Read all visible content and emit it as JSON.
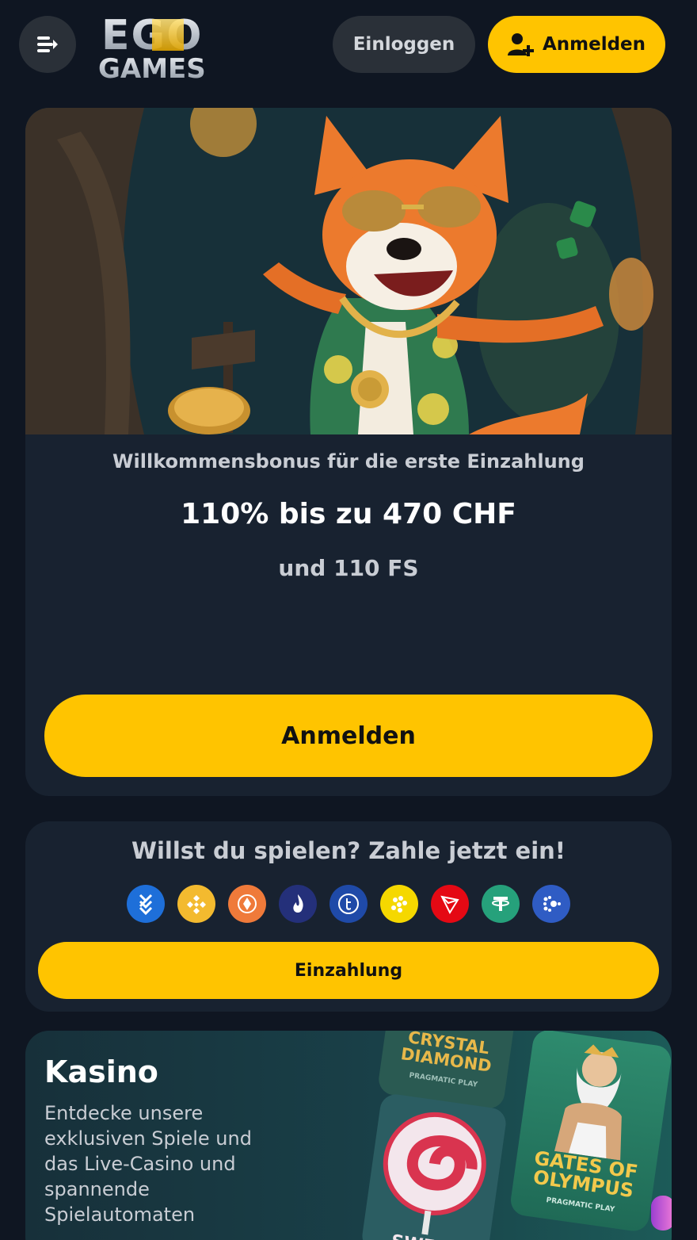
{
  "header": {
    "logo": {
      "top": "EGO",
      "bottom": "GAMES"
    },
    "login_label": "Einloggen",
    "signup_label": "Anmelden"
  },
  "promo": {
    "subtitle": "Willkommensbonus für die erste Einzahlung",
    "headline": "110% bis zu 470 CHF",
    "extra": "und 110 FS",
    "cta_label": "Anmelden"
  },
  "deposit": {
    "title": "Willst du spielen? Zahle jetzt ein!",
    "coins": [
      {
        "name": "bitcoin-blue-icon",
        "color": "#1e6fd9"
      },
      {
        "name": "binance-icon",
        "color": "#f3ba2f"
      },
      {
        "name": "diamond-coin-icon",
        "color": "#ef7a3a"
      },
      {
        "name": "flame-coin-icon",
        "color": "#24307a"
      },
      {
        "name": "tether-t-icon",
        "color": "#1f4aa8"
      },
      {
        "name": "dots-coin-icon",
        "color": "#f5d800"
      },
      {
        "name": "tron-icon",
        "color": "#e50914"
      },
      {
        "name": "usdt-icon",
        "color": "#26a17b"
      },
      {
        "name": "network-coin-icon",
        "color": "#2f5cc4"
      }
    ],
    "cta_label": "Einzahlung"
  },
  "casino": {
    "title": "Kasino",
    "description": "Entdecke unsere exklusiven Spiele und das Live-Casino und spannende Spielautomaten",
    "tiles": [
      {
        "title": "CRYSTAL DIAMOND",
        "maker": "PRAGMATIC PLAY"
      },
      {
        "title": "GATES OF OLYMPUS",
        "maker": "PRAGMATIC PLAY"
      },
      {
        "title": "SWEET",
        "maker": ""
      }
    ]
  },
  "colors": {
    "background": "#0f1622",
    "card": "#182230",
    "accent": "#ffc400",
    "button_dark": "#2a3038"
  }
}
